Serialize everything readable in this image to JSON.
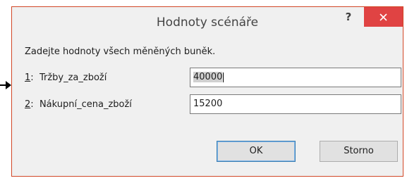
{
  "window": {
    "title": "Hodnoty scénáře",
    "help_label": "?",
    "close_icon": "close-icon"
  },
  "prompt": "Zadejte hodnoty všech měněných buněk.",
  "fields": [
    {
      "index": "1",
      "name": "Tržby_za_zboží",
      "value": "40000"
    },
    {
      "index": "2",
      "name": "Nákupní_cena_zboží",
      "value": "15200"
    }
  ],
  "buttons": {
    "ok": "OK",
    "cancel": "Storno"
  },
  "colors": {
    "accent_border": "#d24726",
    "close_button": "#e04343",
    "dialog_bg": "#f0f0f0"
  }
}
